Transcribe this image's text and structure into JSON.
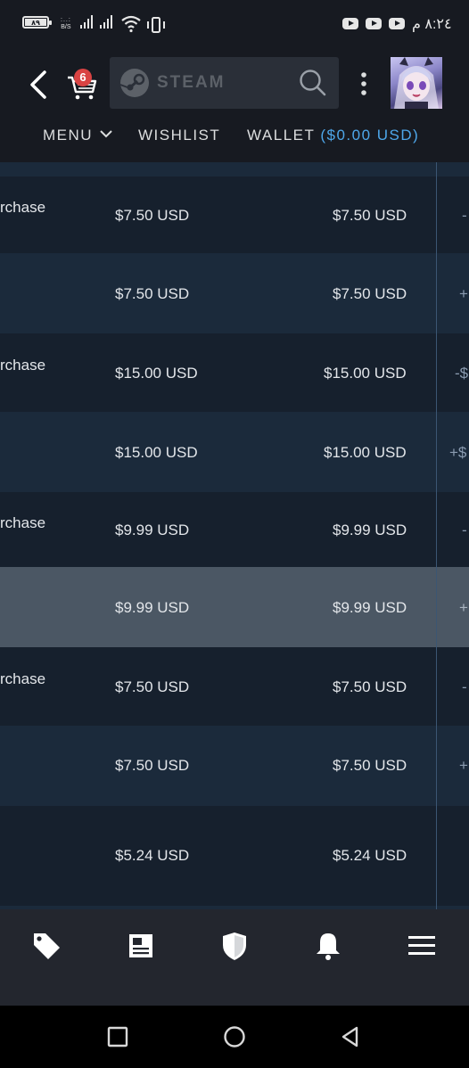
{
  "status_bar": {
    "battery": "٨٩",
    "speed": "B/S",
    "time": "٨:٢٤ م"
  },
  "header": {
    "cart_count": "6",
    "brand": "STEAM",
    "nav": {
      "menu": "MENU",
      "wishlist": "WISHLIST",
      "wallet_label": "WALLET",
      "wallet_balance": "($0.00 USD)"
    }
  },
  "transactions": [
    {
      "type": "rchase",
      "price": "$7.50 USD",
      "total": "$7.50 USD",
      "change": "-"
    },
    {
      "type": "",
      "price": "$7.50 USD",
      "total": "$7.50 USD",
      "change": "+"
    },
    {
      "type": "rchase",
      "price": "$15.00 USD",
      "total": "$15.00 USD",
      "change": "-$"
    },
    {
      "type": "",
      "price": "$15.00 USD",
      "total": "$15.00 USD",
      "change": "+$"
    },
    {
      "type": "rchase",
      "price": "$9.99 USD",
      "total": "$9.99 USD",
      "change": "-"
    },
    {
      "type": "",
      "price": "$9.99 USD",
      "total": "$9.99 USD",
      "change": "+"
    },
    {
      "type": "rchase",
      "price": "$7.50 USD",
      "total": "$7.50 USD",
      "change": "-"
    },
    {
      "type": "",
      "price": "$7.50 USD",
      "total": "$7.50 USD",
      "change": "+"
    },
    {
      "type": "",
      "price": "$5.24 USD",
      "total": "$5.24 USD",
      "change": ""
    }
  ],
  "bottom_nav": [
    "tag-icon",
    "news-icon",
    "shield-icon",
    "bell-icon",
    "hamburger-icon"
  ],
  "colors": {
    "accent": "#4ea7ea",
    "badge": "#d94343",
    "selected_row": "#4b5764"
  }
}
